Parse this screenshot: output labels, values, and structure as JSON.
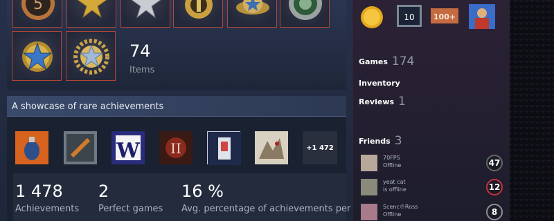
{
  "items": {
    "count": "74",
    "label": "Items"
  },
  "badges": [
    "service-medal-5-icon",
    "gold-star-medal-icon",
    "silver-star-medal-icon",
    "gold-pin-medal-icon",
    "winged-star-medal-icon",
    "green-coin-medal-icon",
    "blue-star-medal-icon",
    "silver-wreath-medal-icon"
  ],
  "showcase": {
    "title": "A showcase of rare achievements",
    "more": "+1 472",
    "achievements": [
      "grenade-icon",
      "wrench-icon",
      "w-letter-icon",
      "roman-two-icon",
      "door-icon",
      "fighter-icon"
    ],
    "stats": [
      {
        "value": "1 478",
        "label": "Achievements"
      },
      {
        "value": "2",
        "label": "Perfect games"
      },
      {
        "value": "16 %",
        "label": "Avg. percentage of achievements per g"
      }
    ]
  },
  "sidebar": {
    "top_badges": [
      {
        "icon": "gold-coin-icon"
      },
      {
        "icon": "level-10-badge-icon",
        "text": "10"
      },
      {
        "icon": "100-plus-badge-icon",
        "text": "100+"
      },
      {
        "icon": "avatar-badge-icon"
      }
    ],
    "games": {
      "label": "Games",
      "count": "174"
    },
    "inventory": {
      "label": "Inventory"
    },
    "reviews": {
      "label": "Reviews",
      "count": "1"
    },
    "friends": {
      "label": "Friends",
      "count": "3"
    },
    "friend_list": [
      {
        "name": "70FPS",
        "status": "Offline",
        "level": "47",
        "level_color": "#5f6a63"
      },
      {
        "name": "yeat cat",
        "status": "is offline",
        "level": "12",
        "level_color": "#c8303a"
      },
      {
        "name": "Scenc℗Ross",
        "status": "Offline",
        "level": "8",
        "level_color": "#8f8f96"
      }
    ]
  }
}
